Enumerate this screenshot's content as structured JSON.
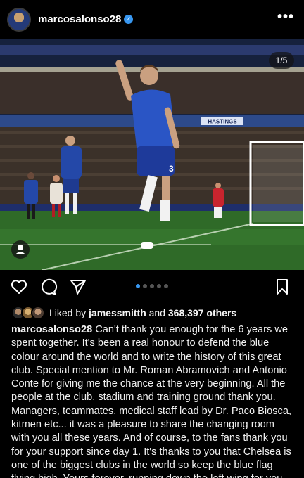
{
  "post": {
    "username": "marcosalonso28",
    "verified_glyph": "✓",
    "more_glyph": "•••",
    "carousel": {
      "current": 1,
      "total": 5,
      "label": "1/5",
      "dot_count": 5
    },
    "likes": {
      "prefix": "Liked by ",
      "user": "jamessmitth",
      "middle": " and ",
      "count": "368,397 others"
    },
    "caption_user": "marcosalonso28",
    "caption_text": "Can't thank you enough for the 6 years we spent together. It's been a real honour to defend the blue colour around the world and to write the history of this great club. Special mention to Mr. Roman Abramovich and Antonio Conte for giving me the chance at the very beginning. All the people at the club, stadium and training ground thank you. Managers, teammates, medical staff lead by Dr. Paco Biosca, kitmen etc... it was a pleasure to share the changing room with you all these years. And of course, to the fans thank you for your support since day 1. It's thanks to you that Chelsea is one of the biggest clubs in the world so keep the blue flag flying high. Yours forever, running down the left wing for you. M",
    "caption_heart": "💙"
  },
  "icons": {
    "like": "heart-outline-icon",
    "comment": "comment-bubble-icon",
    "share": "paper-plane-icon",
    "save": "bookmark-icon",
    "tag": "person-tag-icon",
    "more": "ellipsis-icon",
    "verified": "verified-badge-icon"
  },
  "colors": {
    "accent": "#3897f0",
    "background": "#000000",
    "text": "#f5f5f5"
  },
  "photo": {
    "banner_texts": [
      "HASTINGS"
    ]
  }
}
